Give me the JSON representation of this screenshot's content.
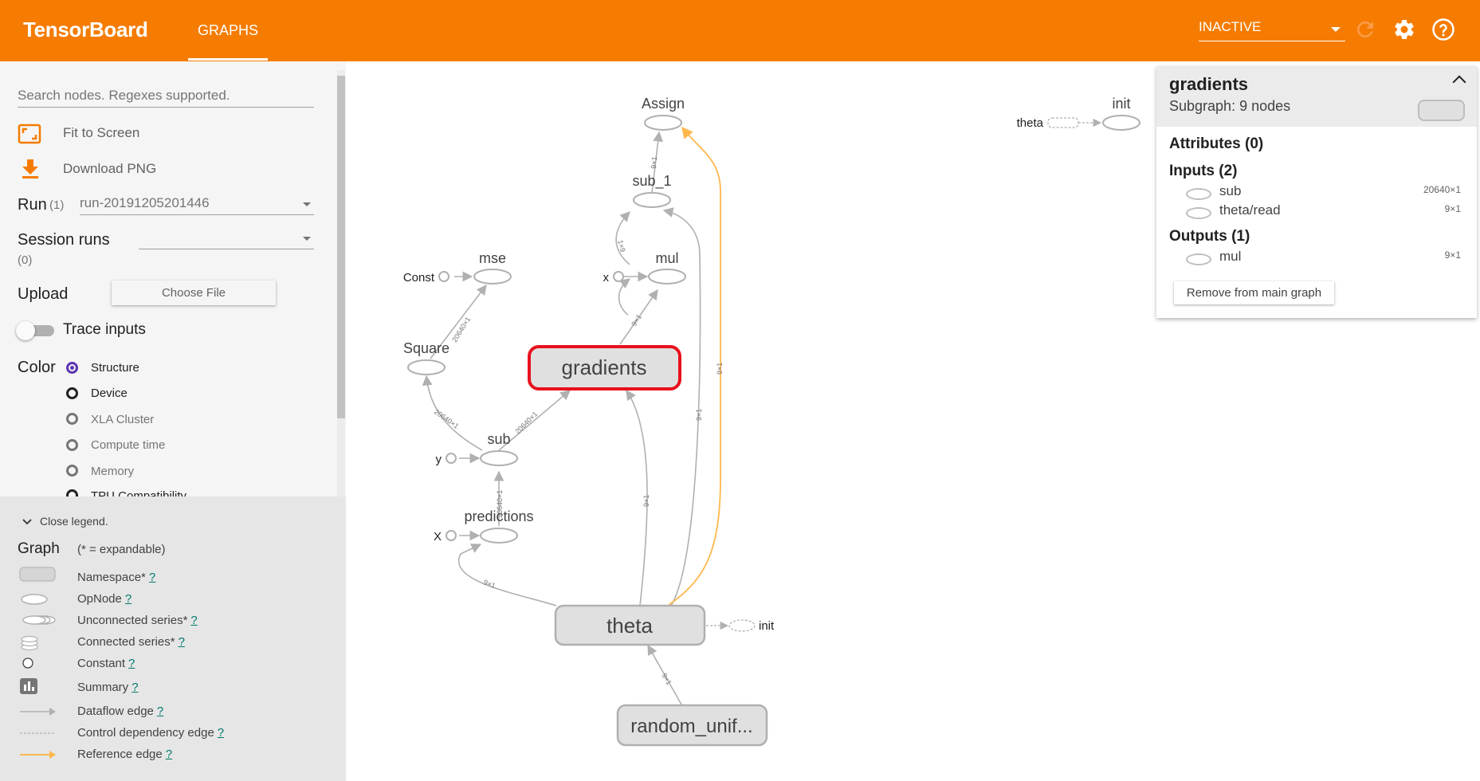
{
  "header": {
    "title": "TensorBoard",
    "tab": "GRAPHS",
    "status": "INACTIVE",
    "icons": [
      "refresh-icon",
      "gear-icon",
      "help-icon"
    ]
  },
  "sidebar": {
    "search_placeholder": "Search nodes. Regexes supported.",
    "fit_label": "Fit to Screen",
    "download_label": "Download PNG",
    "run_label": "Run",
    "run_count": "(1)",
    "run_value": "run-20191205201446",
    "session_label": "Session runs",
    "session_count": "(0)",
    "upload_label": "Upload",
    "choose_file": "Choose File",
    "trace_label": "Trace inputs",
    "color_label": "Color",
    "color_options": [
      "Structure",
      "Device",
      "XLA Cluster",
      "Compute time",
      "Memory",
      "TPU Compatibility"
    ],
    "color_selected": "Structure"
  },
  "legend": {
    "close_label": "Close legend.",
    "graph_label": "Graph",
    "expandable_note": "(* = expandable)",
    "help_mark": "?",
    "items": [
      "Namespace*",
      "OpNode",
      "Unconnected series*",
      "Connected series*",
      "Constant",
      "Summary",
      "Dataflow edge",
      "Control dependency edge",
      "Reference edge"
    ]
  },
  "graph": {
    "nodes": {
      "assign": "Assign",
      "sub1": "sub_1",
      "mse": "mse",
      "const": "Const",
      "mul": "mul",
      "x_small": "x",
      "square": "Square",
      "gradients": "gradients",
      "sub": "sub",
      "y": "y",
      "predictions": "predictions",
      "X": "X",
      "theta": "theta",
      "init": "init",
      "random": "random_unif...",
      "theta_side": "theta",
      "init_side": "init"
    },
    "edge_labels": {
      "e1": "9×1",
      "e2": "1×9",
      "e3": "9×1",
      "e4": "20640×1",
      "e5": "20640×1",
      "e6": "20640×1",
      "e7": "20640×1",
      "e8": "9×1",
      "e9": "9×1",
      "e10": "9×1",
      "e11": "9×1",
      "e12": "9×1"
    },
    "selected": "gradients"
  },
  "info_card": {
    "title": "gradients",
    "subtitle": "Subgraph: 9 nodes",
    "attributes": "Attributes (0)",
    "inputs": "Inputs (2)",
    "input_items": [
      {
        "name": "sub",
        "size": "20640×1"
      },
      {
        "name": "theta/read",
        "size": "9×1"
      }
    ],
    "outputs": "Outputs (1)",
    "output_items": [
      {
        "name": "mul",
        "size": "9×1"
      }
    ],
    "remove_button": "Remove from main graph"
  },
  "colors": {
    "accent": "#f57c00",
    "selected_border": "#e8101c",
    "reference_edge": "#ffb74d",
    "radio_selected": "#5e35b1",
    "help_link": "#00796b"
  }
}
